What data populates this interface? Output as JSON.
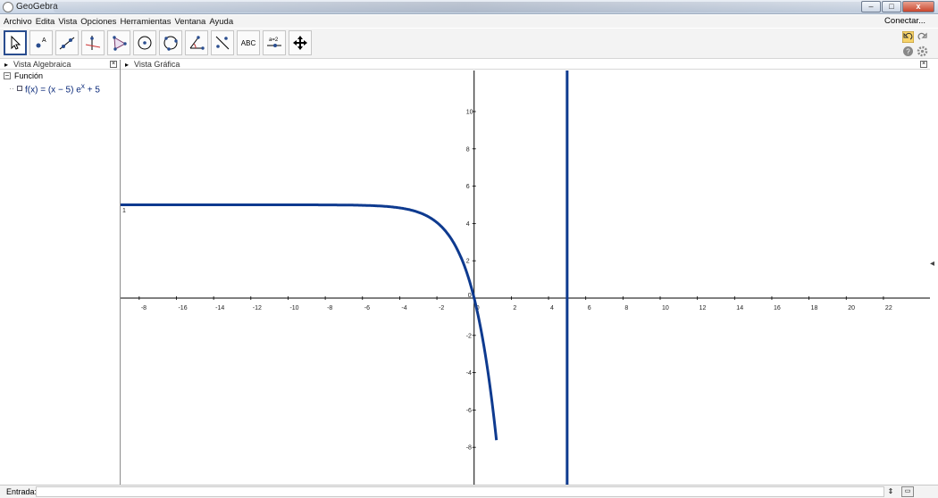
{
  "window": {
    "title": "GeoGebra",
    "minimize": "–",
    "maximize": "□",
    "close": "x"
  },
  "menu": {
    "items": [
      "Archivo",
      "Edita",
      "Vista",
      "Opciones",
      "Herramientas",
      "Ventana",
      "Ayuda"
    ],
    "right": "Conectar..."
  },
  "toolbar": {
    "tools": [
      "move-tool",
      "point-tool",
      "line-tool",
      "perpendicular-tool",
      "polygon-tool",
      "circle-center-tool",
      "circle-three-points-tool",
      "angle-tool",
      "reflect-tool",
      "text-tool",
      "slider-tool",
      "move-graphics-tool"
    ],
    "text_tool_label": "ABC",
    "slider_tool_label": "a=2",
    "right_icons": [
      "undo-icon",
      "redo-icon",
      "help-icon",
      "settings-icon"
    ]
  },
  "algebra": {
    "header": "Vista Algebraica",
    "category": "Función",
    "expression_prefix": "f(x) = (x − 5) e",
    "expression_exp": "x",
    "expression_suffix": " + 5"
  },
  "graphics": {
    "header": "Vista Gráfica",
    "line_label": "1",
    "x_ticks": [
      "-8",
      "-16",
      "-14",
      "-12",
      "-10",
      "-8",
      "-6",
      "-4",
      "-2",
      "0",
      "2",
      "4",
      "6",
      "8",
      "10",
      "12",
      "14",
      "16",
      "18",
      "20",
      "22"
    ],
    "y_ticks": [
      "10",
      "8",
      "6",
      "4",
      "2",
      "-2",
      "-4",
      "-6",
      "-8"
    ],
    "accent": "#0e3a8f"
  },
  "input": {
    "label": "Entrada:",
    "value": ""
  },
  "chart_data": {
    "type": "line",
    "title": "",
    "xlabel": "",
    "ylabel": "",
    "xlim": [
      -19,
      24.5
    ],
    "ylim": [
      -10,
      12.2
    ],
    "series": [
      {
        "name": "f",
        "expression": "(x - 5) e^x + 5",
        "x_range": [
          -19,
          1.2
        ]
      },
      {
        "name": "",
        "expression": "x = 5",
        "type": "vertical_line"
      }
    ]
  }
}
